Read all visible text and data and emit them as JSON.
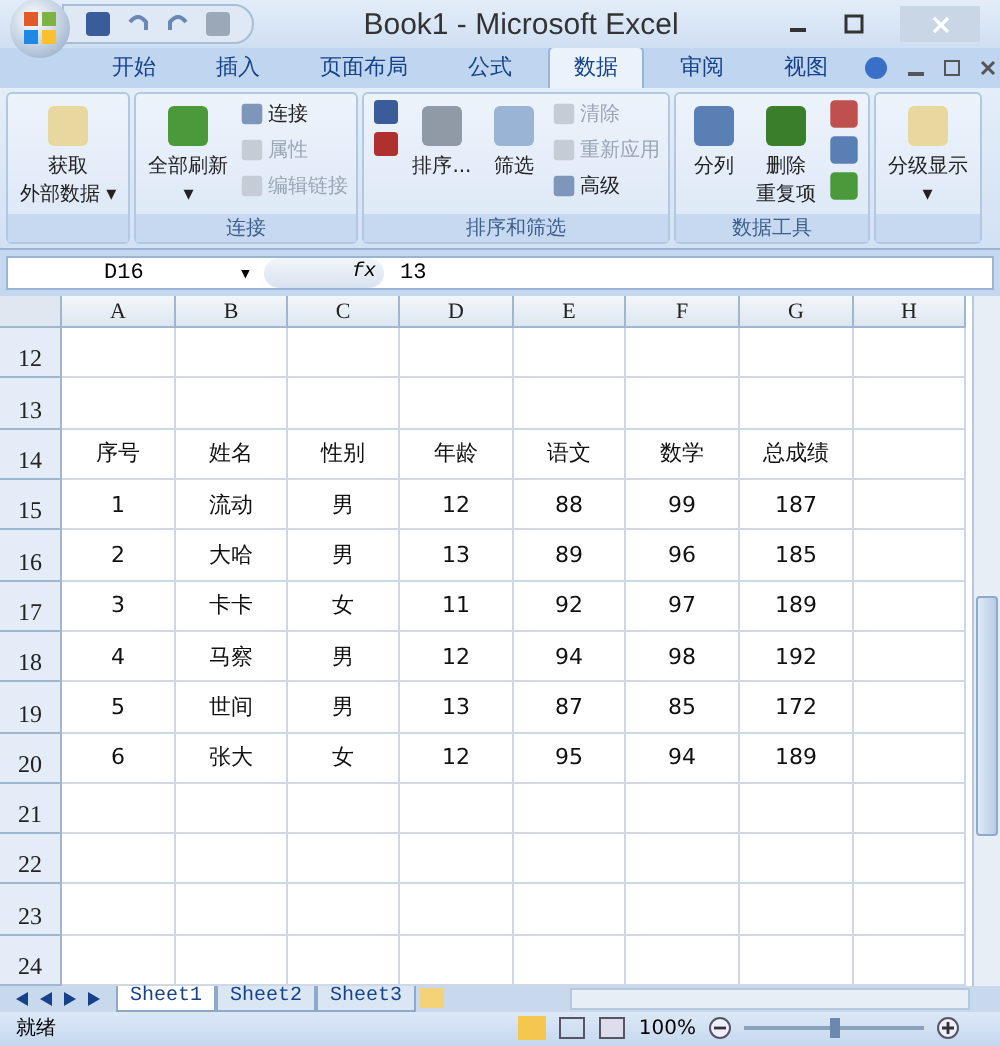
{
  "window": {
    "title": "Book1 - Microsoft Excel"
  },
  "tabs": [
    {
      "label": "开始",
      "selected": false
    },
    {
      "label": "插入",
      "selected": false
    },
    {
      "label": "页面布局",
      "selected": false
    },
    {
      "label": "公式",
      "selected": false
    },
    {
      "label": "数据",
      "selected": true
    },
    {
      "label": "审阅",
      "selected": false
    },
    {
      "label": "视图",
      "selected": false
    }
  ],
  "ribbon": {
    "groups": [
      {
        "buttons": [
          {
            "kind": "large",
            "lines": [
              "获取",
              "外部数据 ▾"
            ]
          }
        ]
      },
      {
        "label": "连接",
        "buttons": [
          {
            "kind": "large",
            "lines": [
              "全部刷新",
              "▾"
            ]
          },
          {
            "kind": "small",
            "label": "连接",
            "disabled": false
          },
          {
            "kind": "small",
            "label": "属性",
            "disabled": true
          },
          {
            "kind": "small",
            "label": "编辑链接",
            "disabled": true
          }
        ]
      },
      {
        "label": "排序和筛选",
        "buttons": [
          {
            "kind": "sortaz"
          },
          {
            "kind": "large",
            "lines": [
              "排序..."
            ]
          },
          {
            "kind": "large",
            "lines": [
              "筛选"
            ]
          },
          {
            "kind": "small",
            "label": "清除",
            "disabled": true
          },
          {
            "kind": "small",
            "label": "重新应用",
            "disabled": true
          },
          {
            "kind": "small",
            "label": "高级",
            "disabled": false
          }
        ]
      },
      {
        "label": "数据工具",
        "buttons": [
          {
            "kind": "large",
            "lines": [
              "分列"
            ]
          },
          {
            "kind": "large",
            "lines": [
              "删除",
              "重复项"
            ]
          },
          {
            "kind": "iconcol"
          }
        ]
      },
      {
        "buttons": [
          {
            "kind": "large",
            "lines": [
              "分级显示",
              "▾"
            ]
          }
        ]
      }
    ]
  },
  "formula_bar": {
    "name_box": "D16",
    "caret": "▾",
    "fx": "fx",
    "value": "13"
  },
  "columns": [
    "A",
    "B",
    "C",
    "D",
    "E",
    "F",
    "G",
    "H"
  ],
  "rows": [
    {
      "number": "12",
      "cells": []
    },
    {
      "number": "13",
      "cells": []
    },
    {
      "number": "14",
      "cells": [
        "序号",
        "姓名",
        "性别",
        "年龄",
        "语文",
        "数学",
        "总成绩"
      ]
    },
    {
      "number": "15",
      "cells": [
        "1",
        "流动",
        "男",
        "12",
        "88",
        "99",
        "187"
      ]
    },
    {
      "number": "16",
      "cells": [
        "2",
        "大哈",
        "男",
        "13",
        "89",
        "96",
        "185"
      ]
    },
    {
      "number": "17",
      "cells": [
        "3",
        "卡卡",
        "女",
        "11",
        "92",
        "97",
        "189"
      ]
    },
    {
      "number": "18",
      "cells": [
        "4",
        "马察",
        "男",
        "12",
        "94",
        "98",
        "192"
      ]
    },
    {
      "number": "19",
      "cells": [
        "5",
        "世间",
        "男",
        "13",
        "87",
        "85",
        "172"
      ]
    },
    {
      "number": "20",
      "cells": [
        "6",
        "张大",
        "女",
        "12",
        "95",
        "94",
        "189"
      ]
    },
    {
      "number": "21",
      "cells": []
    },
    {
      "number": "22",
      "cells": []
    },
    {
      "number": "23",
      "cells": []
    },
    {
      "number": "24",
      "cells": []
    }
  ],
  "sheets": [
    {
      "label": "Sheet1",
      "selected": true
    },
    {
      "label": "Sheet2",
      "selected": false
    },
    {
      "label": "Sheet3",
      "selected": false
    }
  ],
  "status_bar": {
    "status": "就绪",
    "zoom": "100%",
    "zoom_slider": {
      "level": 0.5
    }
  }
}
